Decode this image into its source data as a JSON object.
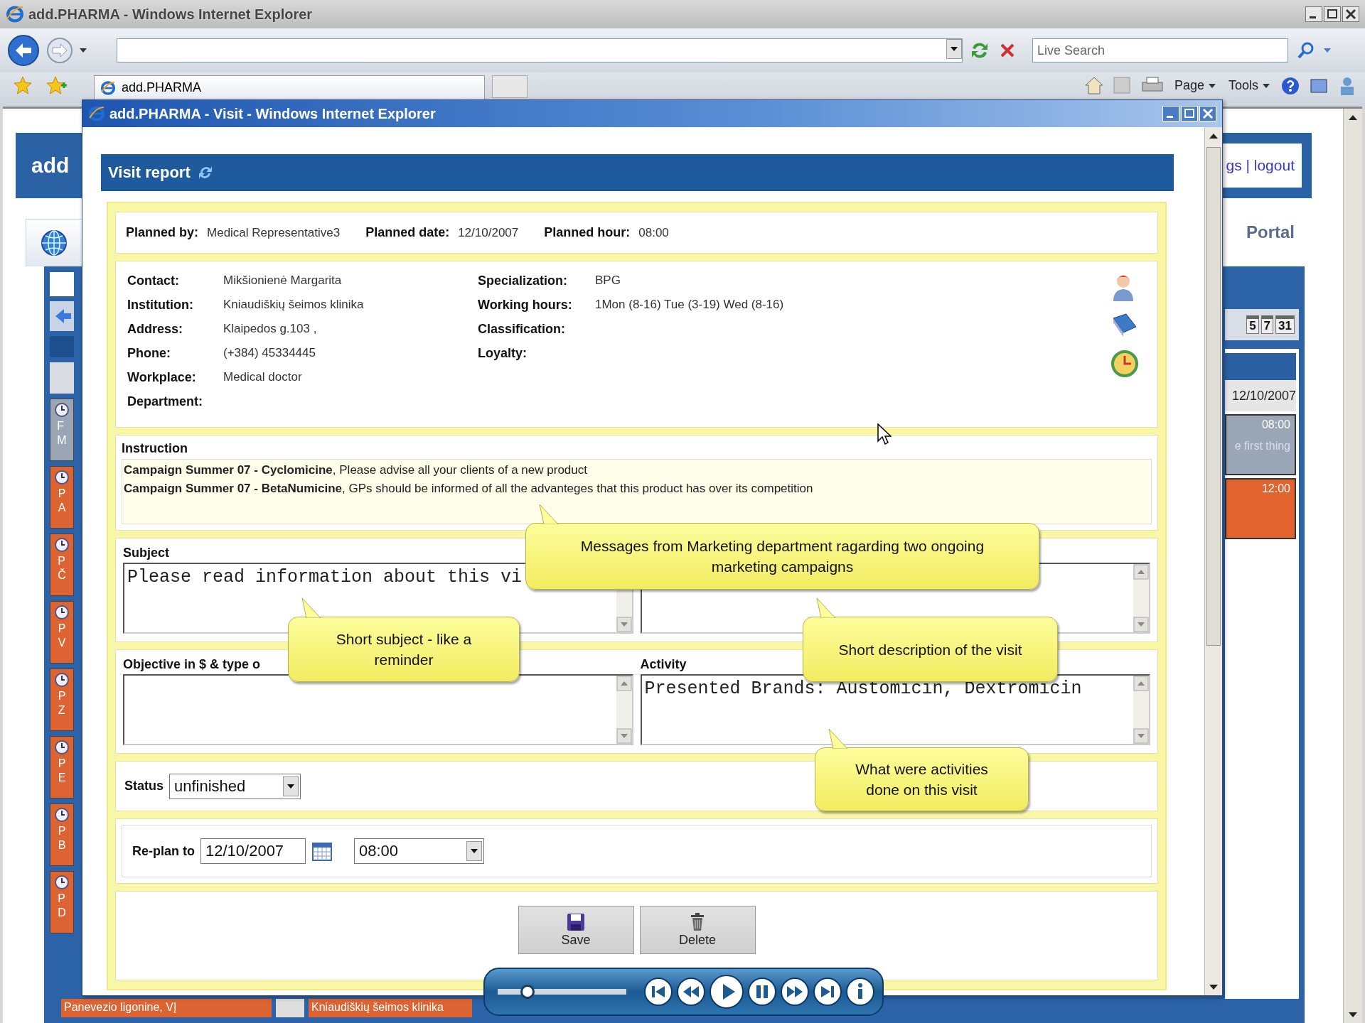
{
  "browser": {
    "title": "add.PHARMA - Windows Internet Explorer",
    "search": {
      "placeholder": "Live Search"
    },
    "tab": "add.PHARMA",
    "menus": [
      "Page",
      "Tools"
    ]
  },
  "background_page": {
    "logo": "add",
    "header_links": "gs | logout",
    "portal": "Portal",
    "visit_rows": [
      {
        "lines": [
          "F",
          "M"
        ],
        "color": "#9aa5b6"
      },
      {
        "lines": [
          "P",
          "A"
        ],
        "color": "#dd6432"
      },
      {
        "lines": [
          "P",
          "Č"
        ],
        "color": "#dd6432"
      },
      {
        "lines": [
          "P",
          "V"
        ],
        "color": "#dd6432"
      },
      {
        "lines": [
          "P",
          "Z"
        ],
        "color": "#dd6432"
      },
      {
        "lines": [
          "P",
          "E"
        ],
        "color": "#dd6432"
      },
      {
        "lines": [
          "P",
          "B"
        ],
        "color": "#dd6432"
      },
      {
        "lines": [
          "P",
          "D"
        ],
        "color": "#dd6432"
      }
    ],
    "bottom_cells": [
      "Panevezio ligonine, VĮ",
      "Kniaudiškių šeimos klinika"
    ],
    "calendar_buttons": [
      "5",
      "7",
      "31"
    ],
    "date": "12/10/2007",
    "appointments": [
      {
        "time": "08:00",
        "text": "e first thing",
        "color": "#9aa5b6"
      },
      {
        "time": "12:00",
        "color": "#e2632e"
      }
    ]
  },
  "visit_window": {
    "title": "add.PHARMA - Visit - Windows Internet Explorer",
    "header": "Visit report",
    "planned": [
      {
        "label": "Planned by:",
        "value": "Medical Representative3"
      },
      {
        "label": "Planned date:",
        "value": "12/10/2007"
      },
      {
        "label": "Planned hour:",
        "value": "08:00"
      }
    ],
    "contact_left": [
      {
        "label": "Contact:",
        "value": "Mikšionienė Margarita"
      },
      {
        "label": "Institution:",
        "value": "Kniaudiškių šeimos klinika"
      },
      {
        "label": "Address:",
        "value": "Klaipedos g.103 ,"
      },
      {
        "label": "Phone:",
        "value": "(+384) 45334445"
      },
      {
        "label": "Workplace:",
        "value": "Medical doctor"
      },
      {
        "label": "Department:"
      }
    ],
    "contact_right": [
      {
        "label": "Specialization:",
        "value": "BPG"
      },
      {
        "label": "Working hours:",
        "value": "1Mon (8-16) Tue (3-19) Wed (8-16)"
      },
      {
        "label": "Classification:"
      },
      {
        "label": "Loyalty:"
      }
    ],
    "instruction": {
      "label": "Instruction",
      "lines": [
        "**Campaign Summer 07 - Cyclomicine**, Please advise all your clients of a new product",
        "**Campaign Summer 07 - BetaNumicine**, GPs should be informed of all the advanteges that this product has over its competition"
      ]
    },
    "subject": {
      "label": "Subject",
      "value": "Please read information about this vi"
    },
    "objective": {
      "label": "Objective in $ & type o"
    },
    "activity": {
      "label": "Activity",
      "value": "Presented Brands: Austomicin, Dextromicin"
    },
    "status": {
      "label": "Status",
      "value": "unfinished"
    },
    "replan": {
      "label": "Re-plan to",
      "date": "12/10/2007",
      "time": "08:00"
    },
    "buttons": [
      {
        "label": "Save",
        "kind": "save"
      },
      {
        "label": "Delete",
        "kind": "delete"
      }
    ]
  },
  "callouts": [
    "Messages from Marketing department ragarding two ongoing marketing campaigns",
    "Short subject - like a reminder",
    "Short description of the visit",
    "What were activities done on this visit"
  ],
  "media_player": {
    "level": 0.2
  }
}
